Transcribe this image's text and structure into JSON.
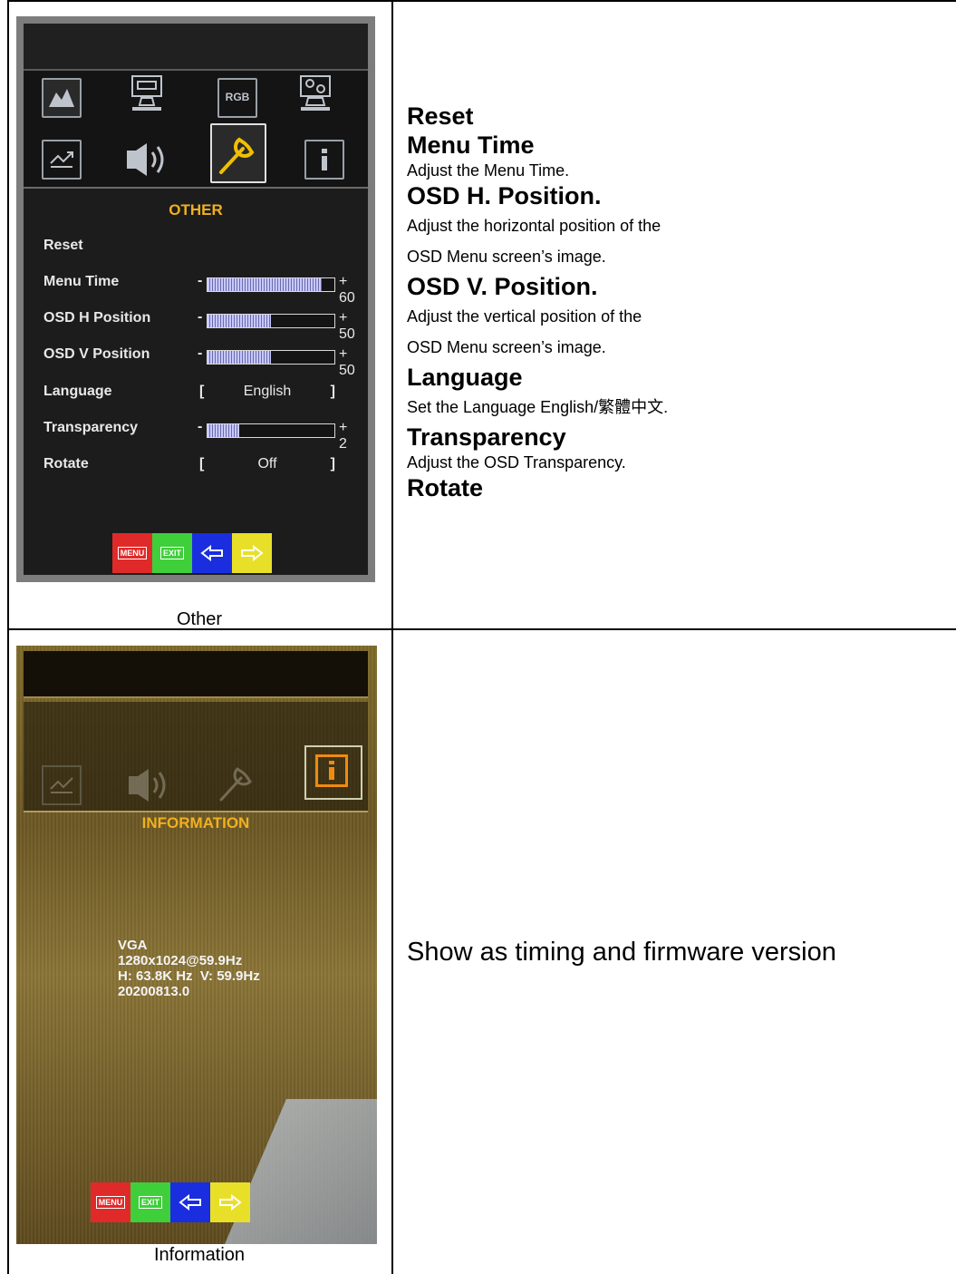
{
  "other_panel": {
    "menu_title": "OTHER",
    "icon_rgb_label": "RGB",
    "rows": [
      {
        "label": "Reset"
      },
      {
        "label": "Menu Time",
        "value": "+ 60",
        "level": 0.9
      },
      {
        "label": "OSD H Position",
        "value": "+ 50",
        "level": 0.5
      },
      {
        "label": "OSD V Position",
        "value": "+ 50",
        "level": 0.5
      },
      {
        "label": "Language",
        "option": "English"
      },
      {
        "label": "Transparency",
        "value": "+ 2",
        "level": 0.25
      },
      {
        "label": "Rotate",
        "option": "Off"
      }
    ],
    "bracket_left": "[",
    "bracket_right": "]",
    "minus": "-",
    "caption": "Other"
  },
  "info_panel": {
    "menu_title": "INFORMATION",
    "lines": [
      "VGA",
      "1280x1024@59.9Hz",
      "H: 63.8K Hz  V: 59.9Hz",
      "20200813.0"
    ],
    "caption": "Information"
  },
  "buttons": {
    "menu": "MENU",
    "exit": "EXIT"
  },
  "descriptions": {
    "reset_title": "Reset",
    "menu_time_title": "Menu Time",
    "menu_time_text": "Adjust the Menu Time.",
    "h_pos_title": "OSD H. Position.",
    "h_pos_text_1": "Adjust the horizontal position of the",
    "h_pos_text_2": "OSD Menu screen’s image.",
    "v_pos_title": "OSD V. Position.",
    "v_pos_text_1": "Adjust the vertical position of the",
    "v_pos_text_2": "OSD Menu screen’s image.",
    "language_title": "Language",
    "language_text": "Set the Language English/繁體中文.",
    "transparency_title": "Transparency",
    "transparency_text": "Adjust the OSD Transparency.",
    "rotate_title": "Rotate",
    "info_text": "Show as timing and firmware version"
  }
}
